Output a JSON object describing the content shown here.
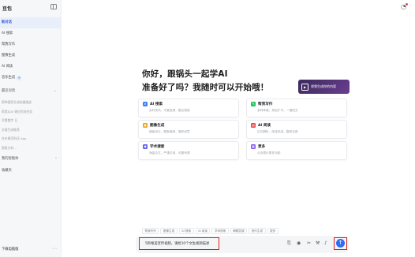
{
  "sidebar": {
    "logo": "豆包",
    "items": [
      {
        "label": "新对话",
        "active": true
      },
      {
        "label": "AI 搜索"
      },
      {
        "label": "帮我写作"
      },
      {
        "label": "图像生成"
      },
      {
        "label": "AI 阅读"
      },
      {
        "label": "音乐生成",
        "badge": "+"
      }
    ],
    "recent_heading": "最近对话",
    "history": [
      "那种图形生成拍摄描述",
      "帮我从AI 做出完成任务",
      "早晨散步 日",
      "文案生成推荐",
      "在车辆识别还 App",
      "图表分析…"
    ],
    "my_agents": "我的智能体",
    "favorites": "收藏夹",
    "download": "下载电脑版"
  },
  "hero": {
    "line1": "你好，跟锅头一起学AI",
    "line2": "准备好了吗？我随时可以开始哦！",
    "promo": "视频生成你的内容"
  },
  "cards": [
    {
      "title": "AI 搜索",
      "desc": "实时资讯，丰富信源，整合搜索",
      "icon": "search-icon",
      "color": "#3b82f6"
    },
    {
      "title": "帮我写作",
      "desc": "多种体裁，润色扩写，一键成文",
      "icon": "pen-icon",
      "color": "#22c55e"
    },
    {
      "title": "图像生成",
      "desc": "超级设计，图案演绎，旗帜创意",
      "icon": "image-icon",
      "color": "#f59e0b"
    },
    {
      "title": "AI 阅读",
      "desc": "论文解析，阅读总结，翻译全部",
      "icon": "book-icon",
      "color": "#ef4444"
    },
    {
      "title": "学术搜索",
      "desc": "海量论文，严谨引用，可靠来源",
      "icon": "graduation-icon",
      "color": "#6366f1"
    },
    {
      "title": "更多",
      "desc": "点击展示更多功能",
      "icon": "grid-icon",
      "color": "#8b5cf6"
    }
  ],
  "chips": [
    "帮我写作",
    "图像生成",
    "AI 搜索",
    "AI 阅读",
    "学术搜索",
    "解题答疑",
    "音乐生成",
    "更多"
  ],
  "input": {
    "value": "5秒唯美宣传视频，请给10个文生视频描述"
  },
  "colors": {
    "accent": "#2f6cf3",
    "highlight": "#e01e1e"
  }
}
